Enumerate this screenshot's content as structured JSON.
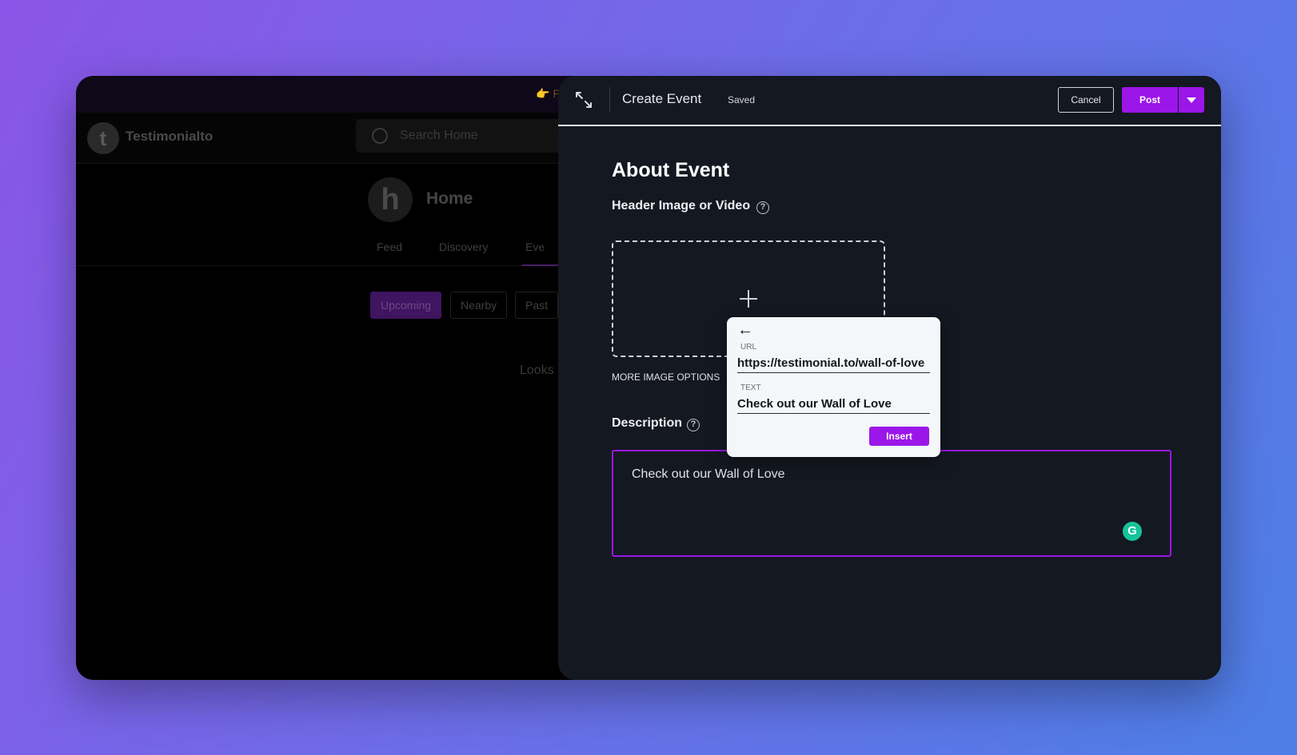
{
  "background_app": {
    "banner_text": "👉 Fr",
    "logo_letter": "t",
    "brand_name": "Testimonialto",
    "search_placeholder": "Search Home",
    "home_avatar_letter": "h",
    "home_title": "Home",
    "tabs": [
      {
        "label": "Feed"
      },
      {
        "label": "Discovery"
      },
      {
        "label": "Eve"
      }
    ],
    "filters": [
      {
        "label": "Upcoming",
        "active": true
      },
      {
        "label": "Nearby",
        "active": false
      },
      {
        "label": "Past",
        "active": false
      }
    ],
    "empty_text": "Looks"
  },
  "drawer": {
    "title": "Create Event",
    "status": "Saved",
    "cancel_label": "Cancel",
    "post_label": "Post",
    "section_title": "About Event",
    "header_image_label": "Header Image or Video",
    "more_image_options": "MORE IMAGE OPTIONS",
    "description_label": "Description",
    "description_text": "Check out our Wall of Love"
  },
  "link_popover": {
    "url_label": "URL",
    "url_value": "https://testimonial.to/wall-of-love",
    "text_label": "TEXT",
    "text_value": "Check out our Wall of Love",
    "insert_label": "Insert"
  },
  "colors": {
    "accent": "#9b16e8",
    "drawer_bg": "#141821",
    "grammarly": "#15c39a"
  },
  "icons": {
    "expand": "expand-icon",
    "help": "help-circle-icon",
    "plus": "plus-icon",
    "back": "arrow-left-icon",
    "caret": "caret-down-icon",
    "search": "search-icon",
    "grammarly": "grammarly-icon"
  }
}
